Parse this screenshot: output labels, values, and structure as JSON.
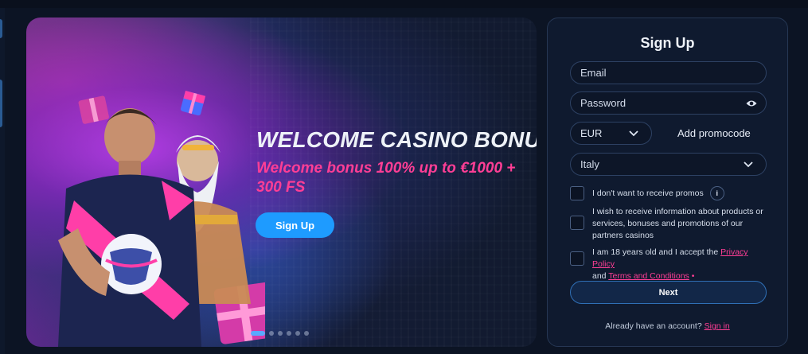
{
  "banner": {
    "title": "WELCOME CASINO BONUS",
    "subtitle": "Welcome bonus 100% up to €1000 + 300 FS",
    "cta_label": "Sign Up",
    "slides_total": 6,
    "active_slide": 1
  },
  "signup": {
    "title": "Sign Up",
    "email_placeholder": "Email",
    "password_placeholder": "Password",
    "currency": "EUR",
    "add_promocode": "Add promocode",
    "country": "Italy",
    "promo_opt_out": "I don't want to receive promos",
    "info_icon_label": "i",
    "partner_info_text": "I wish to receive information about products or services, bonuses and promotions of our partners casinos",
    "age_text_prefix": "I am 18 years old and I accept the ",
    "privacy_link": "Privacy Policy",
    "and_text": " and ",
    "terms_link": "Terms and Conditions",
    "required_mark": " •",
    "next_label": "Next",
    "already_account": "Already have an account?",
    "sign_in_link": "Sign in"
  },
  "colors": {
    "accent_pink": "#ff3e95",
    "accent_blue": "#1e9bff",
    "panel_bg": "#0f1a2f"
  }
}
